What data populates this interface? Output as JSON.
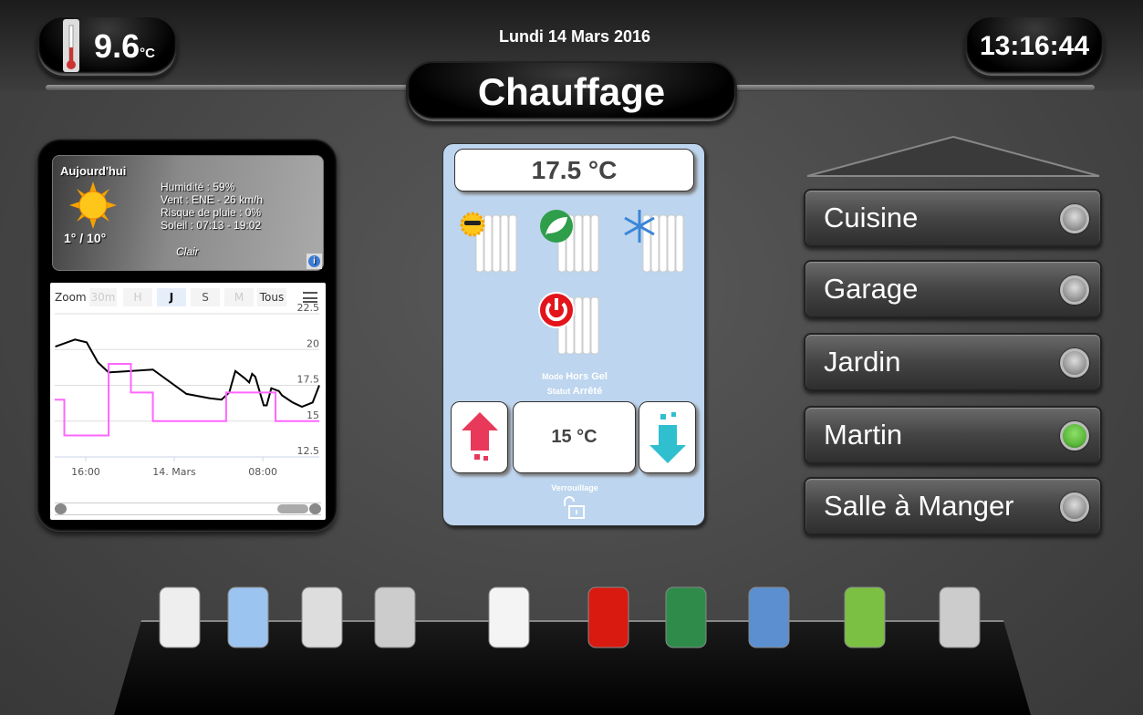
{
  "header": {
    "outdoor_temp": "9.6",
    "temp_unit": "°C",
    "date": "Lundi 14 Mars 2016",
    "title": "Chauffage",
    "clock": "13:16:44"
  },
  "weather": {
    "heading": "Aujourd'hui",
    "icon": "sun-icon",
    "minmax": "1° / 10°",
    "humidity": "Humidité : 59%",
    "wind": "Vent : ENE - 26 km/h",
    "rain": "Risque de pluie : 0%",
    "sun": "Soleil : 07:13 - 19:02",
    "condition": "Clair"
  },
  "chart_controls": {
    "zoom_label": "Zoom",
    "ranges": [
      "30m",
      "H",
      "J",
      "S",
      "M",
      "Tous"
    ],
    "selected": "J"
  },
  "chart_data": {
    "type": "line",
    "xlim": [
      "2016-03-13T13:12",
      "2016-03-14T13:06"
    ],
    "ylim": [
      12.5,
      22.5
    ],
    "yticks": [
      "12.5",
      "15",
      "17.5",
      "20",
      "22.5"
    ],
    "xticks": [
      {
        "t": "2016-03-13T16:00",
        "label": "16:00"
      },
      {
        "t": "2016-03-14T00:00",
        "label": "14. Mars"
      },
      {
        "t": "2016-03-14T08:00",
        "label": "08:00"
      }
    ],
    "grid": true,
    "series": [
      {
        "color": "#000000",
        "step": false,
        "points": [
          [
            "2016-03-13T13:15",
            20.2
          ],
          [
            "2016-03-13T15:02",
            20.7
          ],
          [
            "2016-03-13T16:05",
            20.5
          ],
          [
            "2016-03-13T17:06",
            19.1
          ],
          [
            "2016-03-13T18:04",
            18.4
          ],
          [
            "2016-03-13T22:04",
            18.6
          ],
          [
            "2016-03-14T01:06",
            16.9
          ],
          [
            "2016-03-14T03:10",
            16.6
          ],
          [
            "2016-03-14T04:16",
            16.5
          ],
          [
            "2016-03-14T04:58",
            17.0
          ],
          [
            "2016-03-14T05:31",
            18.5
          ],
          [
            "2016-03-14T06:21",
            18.0
          ],
          [
            "2016-03-14T06:46",
            17.7
          ],
          [
            "2016-03-14T07:02",
            18.3
          ],
          [
            "2016-03-14T07:19",
            18.1
          ],
          [
            "2016-03-14T08:05",
            16.1
          ],
          [
            "2016-03-14T08:21",
            16.1
          ],
          [
            "2016-03-14T08:46",
            17.3
          ],
          [
            "2016-03-14T09:27",
            17.1
          ],
          [
            "2016-03-14T09:44",
            16.8
          ],
          [
            "2016-03-14T10:42",
            16.3
          ],
          [
            "2016-03-14T11:32",
            16.0
          ],
          [
            "2016-03-14T12:30",
            16.3
          ],
          [
            "2016-03-14T13:06",
            17.5
          ]
        ]
      },
      {
        "color": "#ff66ff",
        "step": true,
        "points": [
          [
            "2016-03-13T13:12",
            16.5
          ],
          [
            "2016-03-13T14:04",
            14.0
          ],
          [
            "2016-03-13T18:04",
            19.0
          ],
          [
            "2016-03-13T20:05",
            17.0
          ],
          [
            "2016-03-13T22:04",
            15.0
          ],
          [
            "2016-03-14T04:41",
            17.0
          ],
          [
            "2016-03-14T09:09",
            15.0
          ],
          [
            "2016-03-14T13:06",
            15.0
          ]
        ]
      }
    ]
  },
  "thermostat": {
    "current_temp": "17.5 °C",
    "modes": [
      {
        "name": "confort",
        "icon": "sun-radiator-icon"
      },
      {
        "name": "eco",
        "icon": "leaf-radiator-icon"
      },
      {
        "name": "hors-gel",
        "icon": "snowflake-radiator-icon"
      },
      {
        "name": "off",
        "icon": "power-radiator-icon"
      }
    ],
    "mode_label": "Mode",
    "mode_value": "Hors Gel",
    "status_label": "Statut",
    "status_value": "Arrêté",
    "setpoint": "15 °C",
    "lock_label": "Verrouillage",
    "lock_state": "unlocked"
  },
  "rooms": [
    {
      "name": "Cuisine",
      "active": false
    },
    {
      "name": "Garage",
      "active": false
    },
    {
      "name": "Jardin",
      "active": false
    },
    {
      "name": "Martin",
      "active": true
    },
    {
      "name": "Salle à Manger",
      "active": false
    }
  ],
  "colors": {
    "led_on": "#5cb83a",
    "panel_bg": "#bdd5ee",
    "setpoint_line": "#ff66ff"
  },
  "dock": [
    "radiator-icon",
    "light-bulb-icon",
    "shutter-icon",
    "camera-icon",
    "gate-icon",
    "alarm-siren-icon",
    "umbrella-weather-icon",
    "multimedia-icon",
    "energy-icon",
    "settings-gears-icon"
  ]
}
